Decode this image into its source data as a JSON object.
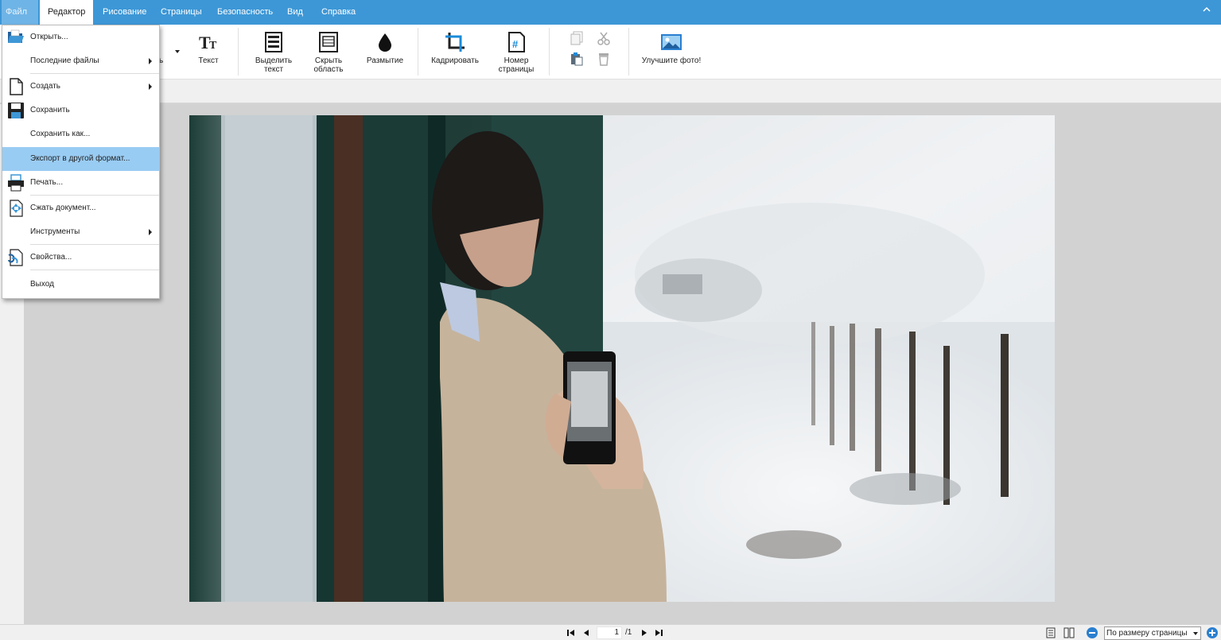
{
  "menubar": {
    "file_label": "Файл",
    "tabs": [
      {
        "label": "Редактор"
      },
      {
        "label": "Рисование"
      },
      {
        "label": "Страницы"
      },
      {
        "label": "Безопасность"
      },
      {
        "label": "Вид"
      },
      {
        "label": "Справка"
      }
    ]
  },
  "ribbon": {
    "partial_label": "сь",
    "text_label": "Текст",
    "select_text_label": "Выделить текст",
    "hide_area_label": "Скрыть область",
    "blur_label": "Размытие",
    "crop_label": "Кадрировать",
    "page_number_label": "Номер страницы",
    "enhance_label": "Улучшите фото!"
  },
  "file_menu": {
    "items": [
      {
        "label": "Открыть..."
      },
      {
        "label": "Последние файлы"
      },
      {
        "label": "Создать"
      },
      {
        "label": "Сохранить"
      },
      {
        "label": "Сохранить как..."
      },
      {
        "label": "Экспорт в другой формат..."
      },
      {
        "label": "Печать..."
      },
      {
        "label": "Сжать документ..."
      },
      {
        "label": "Инструменты"
      },
      {
        "label": "Свойства..."
      },
      {
        "label": "Выход"
      }
    ]
  },
  "statusbar": {
    "page_current": "1",
    "page_total": "/1",
    "zoom_value": "По размеру страницы"
  },
  "colors": {
    "accent": "#3d97d6",
    "highlight": "#99ccf3"
  }
}
